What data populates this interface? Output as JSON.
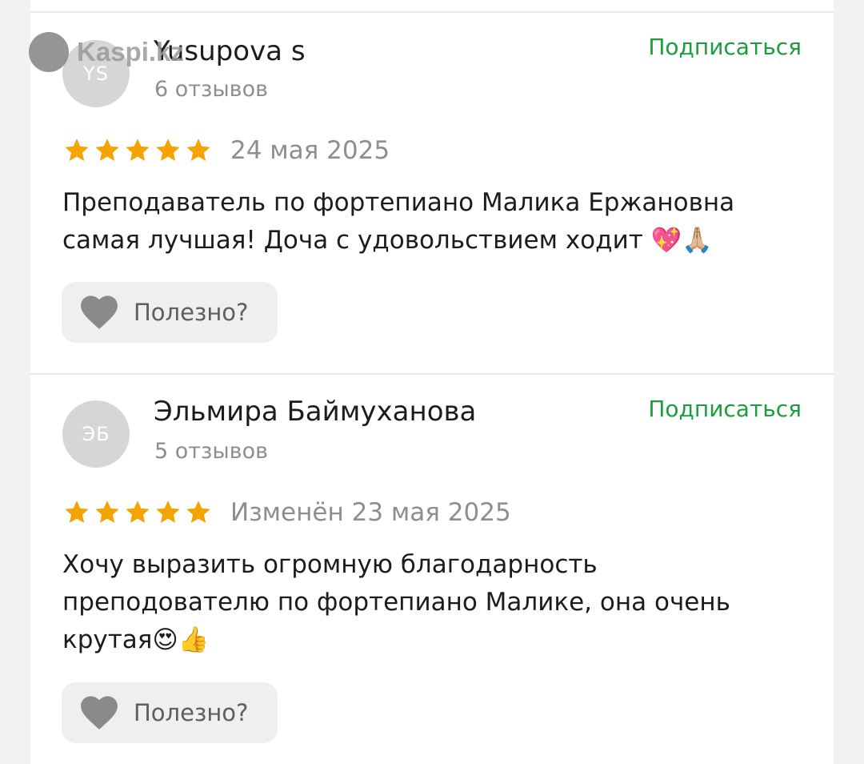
{
  "watermark": {
    "text": "Kaspi.kz"
  },
  "reviews": [
    {
      "initials": "YS",
      "author": "Yusupova s",
      "reviews_count": "6 отзывов",
      "subscribe_label": "Подписаться",
      "rating": 5,
      "date": "24 мая 2025",
      "text_line1": "Преподаватель по фортепиано Малика Ержановна",
      "text_line2": "самая лучшая! Доча с удовольствием ходит 💖🙏🏼",
      "helpful_label": "Полезно?"
    },
    {
      "initials": "ЭБ",
      "author": "Эльмира Баймуханова",
      "reviews_count": "5 отзывов",
      "subscribe_label": "Подписаться",
      "rating": 5,
      "date": "Изменён 23 мая 2025",
      "text_line1": "Хочу выразить огромную благодарность",
      "text_line2": "преподователю по фортепиано Малике, она очень",
      "text_line3": "крутая😍👍",
      "helpful_label": "Полезно?"
    }
  ],
  "colors": {
    "accent_green": "#1b9e3e",
    "star": "#f5a300",
    "muted": "#8e8e8e"
  }
}
